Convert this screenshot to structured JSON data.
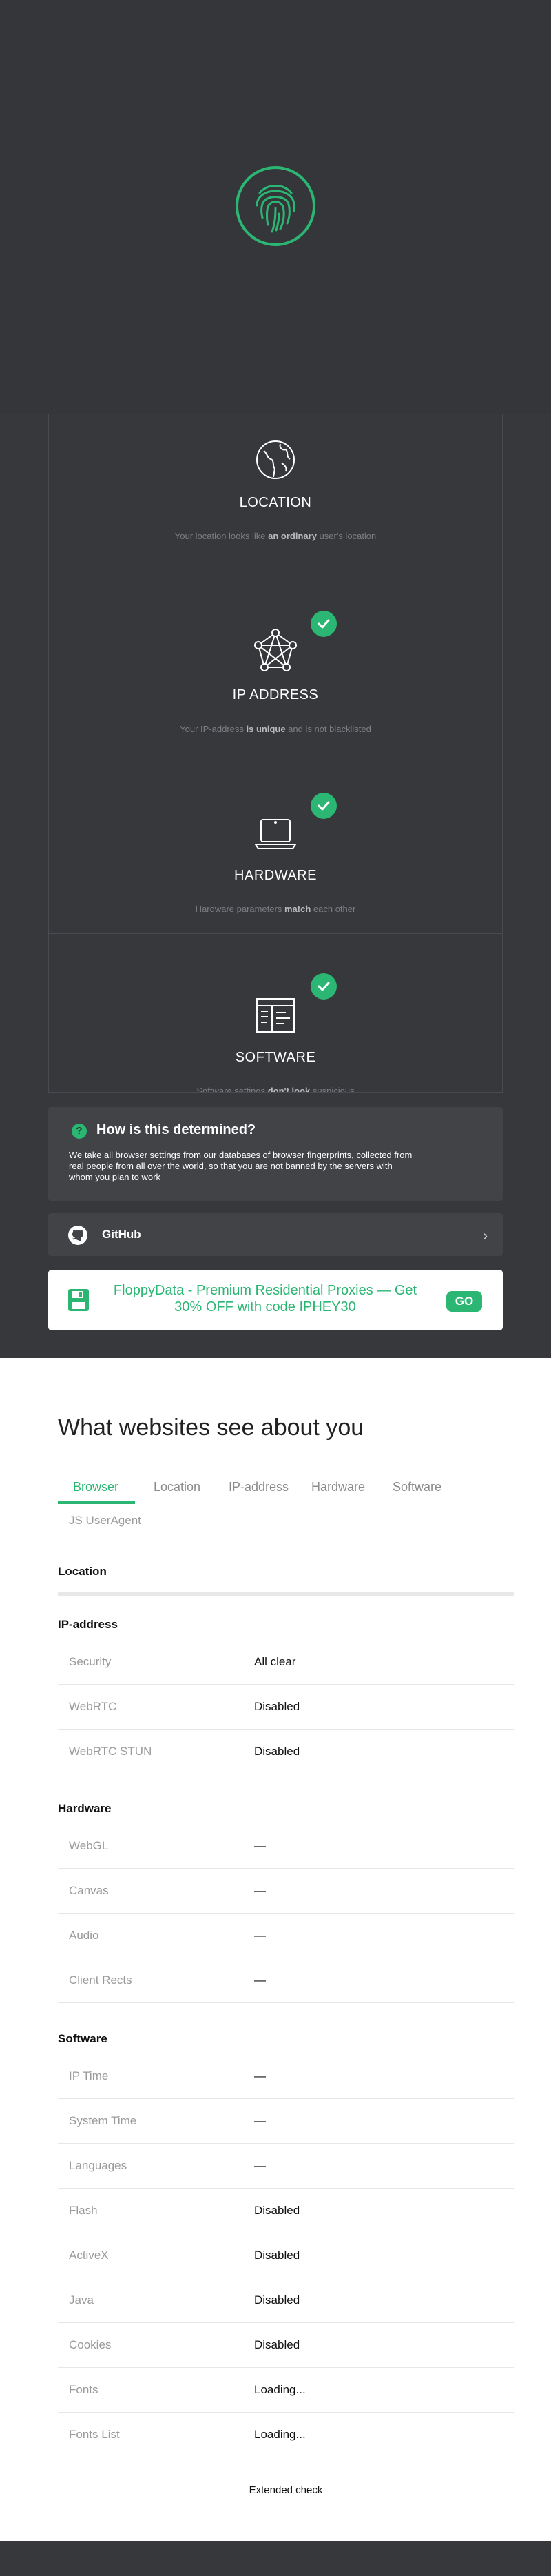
{
  "checks": [
    {
      "icon": "globe-icon",
      "title": "LOCATION",
      "desc_pre": "Your location looks like ",
      "desc_bold": "an ordinary",
      "desc_post": " user's location"
    },
    {
      "icon": "network-icon",
      "title": "IP ADDRESS",
      "desc_pre": "Your IP-address ",
      "desc_bold": "is unique",
      "desc_post": " and is not blacklisted"
    },
    {
      "icon": "laptop-icon",
      "title": "HARDWARE",
      "desc_pre": "Hardware parameters ",
      "desc_bold": "match",
      "desc_post": " each other"
    },
    {
      "icon": "software-window-icon",
      "title": "SOFTWARE",
      "desc_pre": "Software settings ",
      "desc_bold": "don't look",
      "desc_post": " suspicious"
    }
  ],
  "how": {
    "title": "How is this determined?",
    "text": "We take all browser settings from our databases of browser fingerprints, collected from real people from all over the world, so that you are not banned by the servers with whom you plan to work"
  },
  "github": {
    "label": "GitHub"
  },
  "ad": {
    "text": "FloppyData - Premium Residential Proxies — Get 30% OFF with code IPHEY30",
    "button": "GO"
  },
  "report": {
    "title": "What websites see about you",
    "tabs": [
      "Browser",
      "Location",
      "IP-address",
      "Hardware",
      "Software"
    ],
    "browser_item": "JS UserAgent",
    "location_heading": "Location",
    "ip_heading": "IP-address",
    "ip_rows": [
      {
        "key": "Security",
        "value": "All clear"
      },
      {
        "key": "WebRTC",
        "value": "Disabled"
      },
      {
        "key": "WebRTC STUN",
        "value": "Disabled"
      }
    ],
    "hardware_heading": "Hardware",
    "hardware_rows": [
      {
        "key": "WebGL",
        "value": "—"
      },
      {
        "key": "Canvas",
        "value": "—"
      },
      {
        "key": "Audio",
        "value": "—"
      },
      {
        "key": "Client Rects",
        "value": "—"
      }
    ],
    "software_heading": "Software",
    "software_rows": [
      {
        "key": "IP Time",
        "value": "—"
      },
      {
        "key": "System Time",
        "value": "—"
      },
      {
        "key": "Languages",
        "value": "—"
      },
      {
        "key": "Flash",
        "value": "Disabled"
      },
      {
        "key": "ActiveX",
        "value": "Disabled"
      },
      {
        "key": "Java",
        "value": "Disabled"
      },
      {
        "key": "Cookies",
        "value": "Disabled"
      },
      {
        "key": "Fonts",
        "value": "Loading..."
      },
      {
        "key": "Fonts List",
        "value": "Loading..."
      }
    ],
    "extended": "Extended check"
  },
  "colors": {
    "accent": "#2bb673",
    "dark_bg": "#37383c"
  }
}
